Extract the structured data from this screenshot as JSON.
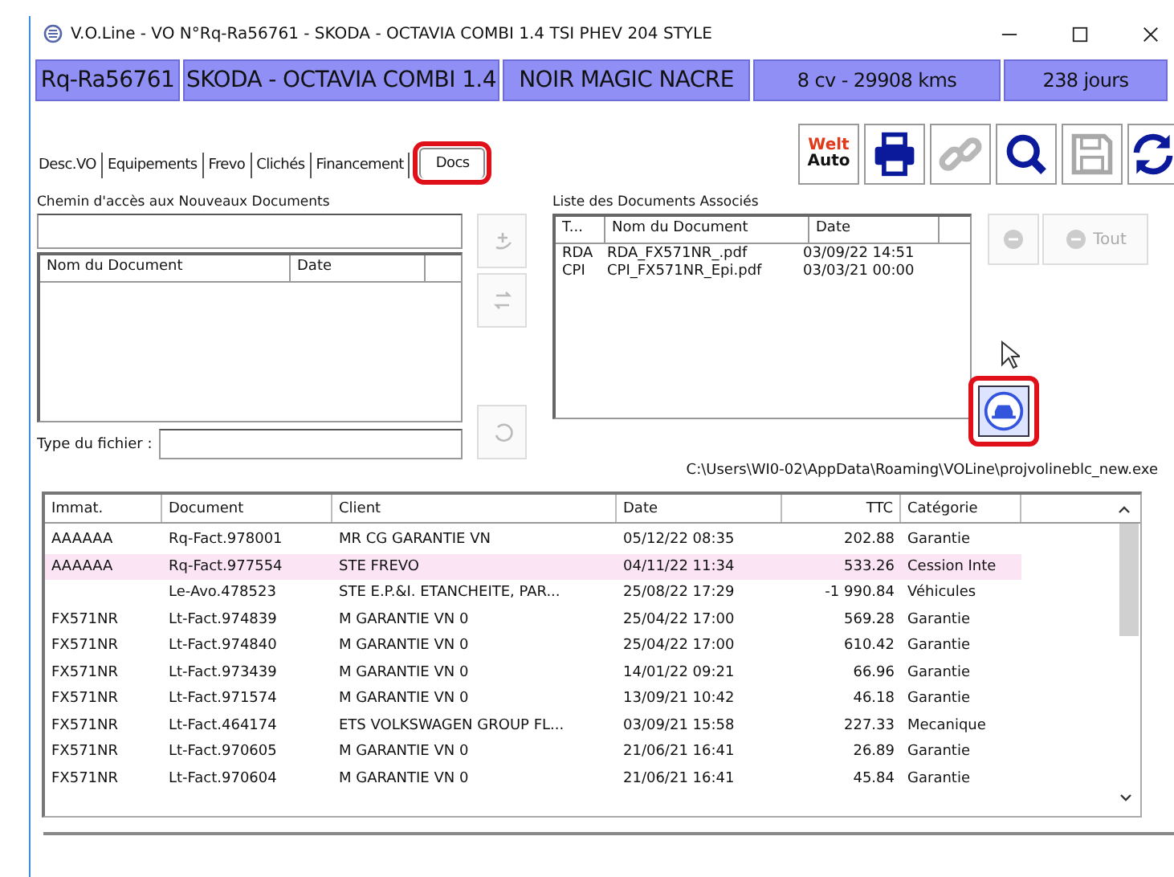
{
  "window": {
    "title": "V.O.Line - VO N°Rq-Ra56761 - SKODA - OCTAVIA COMBI 1.4 TSI PHEV 204  STYLE"
  },
  "header": [
    "Rq-Ra56761",
    "SKODA - OCTAVIA COMBI 1.4",
    "NOIR MAGIC NACRE",
    "8 cv - 29908 kms",
    "238 jours"
  ],
  "toolbar": {
    "logo_top": "Welt",
    "logo_bottom": "Auto"
  },
  "tabs": [
    {
      "label": "Desc.VO",
      "selected": false
    },
    {
      "label": "Equipements",
      "selected": false
    },
    {
      "label": "Frevo",
      "selected": false
    },
    {
      "label": "Clichés",
      "selected": false
    },
    {
      "label": "Financement",
      "selected": false
    },
    {
      "label": "Docs",
      "selected": true
    }
  ],
  "new_docs": {
    "label": "Chemin d'accès aux Nouveaux Documents",
    "columns": [
      "Nom du Document",
      "Date"
    ],
    "type_label": "Type du fichier :"
  },
  "associated_docs": {
    "label": "Liste des Documents Associés",
    "columns": [
      "T...",
      "Nom du Document",
      "Date"
    ],
    "rows": [
      [
        "RDA",
        "RDA_FX571NR_.pdf",
        "03/09/22 14:51"
      ],
      [
        "CPI",
        "CPI_FX571NR_Epi.pdf",
        "03/03/21 00:00"
      ]
    ],
    "all_button": "Tout"
  },
  "path": "C:\\Users\\WI0-02\\AppData\\Roaming\\VOLine\\projvolineblc_new.exe",
  "table": {
    "columns": [
      "Immat.",
      "Document",
      "Client",
      "Date",
      "TTC",
      "Catégorie"
    ],
    "rows": [
      {
        "cells": [
          "AAAAAA",
          "Rq-Fact.978001",
          "MR CG GARANTIE VN",
          "05/12/22 08:35",
          "202.88",
          "Garantie"
        ],
        "selected": false
      },
      {
        "cells": [
          "AAAAAA",
          "Rq-Fact.977554",
          "STE FREVO",
          "04/11/22 11:34",
          "533.26",
          "Cession Inte"
        ],
        "selected": true
      },
      {
        "cells": [
          "",
          "Le-Avo.478523",
          "STE E.P.&I. ETANCHEITE, PAR...",
          "25/08/22 17:29",
          "-1 990.84",
          "Véhicules"
        ],
        "selected": false
      },
      {
        "cells": [
          "FX571NR",
          "Lt-Fact.974839",
          "M GARANTIE VN 0",
          "25/04/22 17:00",
          "569.28",
          "Garantie"
        ],
        "selected": false
      },
      {
        "cells": [
          "FX571NR",
          "Lt-Fact.974840",
          "M GARANTIE VN 0",
          "25/04/22 17:00",
          "610.42",
          "Garantie"
        ],
        "selected": false
      },
      {
        "cells": [
          "FX571NR",
          "Lt-Fact.973439",
          "M GARANTIE VN 0",
          "14/01/22 09:21",
          "66.96",
          "Garantie"
        ],
        "selected": false
      },
      {
        "cells": [
          "FX571NR",
          "Lt-Fact.971574",
          "M GARANTIE VN 0",
          "13/09/21 10:42",
          "46.18",
          "Garantie"
        ],
        "selected": false
      },
      {
        "cells": [
          "FX571NR",
          "Lt-Fact.464174",
          "ETS VOLKSWAGEN GROUP FL...",
          "03/09/21 15:58",
          "227.33",
          "Mecanique"
        ],
        "selected": false
      },
      {
        "cells": [
          "FX571NR",
          "Lt-Fact.970605",
          "M GARANTIE VN 0",
          "21/06/21 16:41",
          "26.89",
          "Garantie"
        ],
        "selected": false
      },
      {
        "cells": [
          "FX571NR",
          "Lt-Fact.970604",
          "M GARANTIE VN 0",
          "21/06/21 16:41",
          "45.84",
          "Garantie"
        ],
        "selected": false
      }
    ]
  }
}
